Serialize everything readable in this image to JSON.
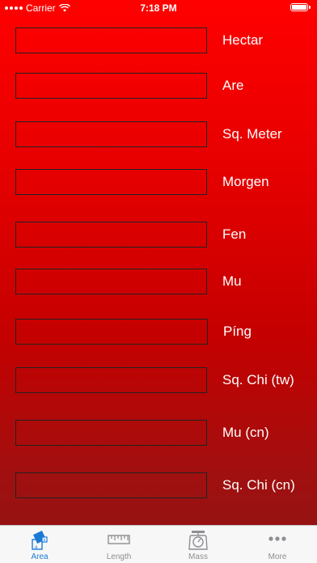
{
  "status_bar": {
    "carrier": "Carrier",
    "time": "7:18 PM"
  },
  "rows": [
    {
      "label": "Hectar",
      "value": ""
    },
    {
      "label": "Are",
      "value": ""
    },
    {
      "label": "Sq. Meter",
      "value": ""
    },
    {
      "label": "Morgen",
      "value": ""
    },
    {
      "label": "Fen",
      "value": ""
    },
    {
      "label": "Mu",
      "value": ""
    },
    {
      "label": "Píng",
      "value": ""
    },
    {
      "label": "Sq. Chi (tw)",
      "value": ""
    },
    {
      "label": "Mu (cn)",
      "value": ""
    },
    {
      "label": "Sq. Chi (cn)",
      "value": ""
    }
  ],
  "tabs": [
    {
      "label": "Area",
      "icon": "area-icon",
      "active": true
    },
    {
      "label": "Length",
      "icon": "ruler-icon",
      "active": false
    },
    {
      "label": "Mass",
      "icon": "scale-icon",
      "active": false
    },
    {
      "label": "More",
      "icon": "more-icon",
      "active": false
    }
  ],
  "colors": {
    "background_top": "#ff0000",
    "background_bottom": "#8e1414",
    "tab_active": "#1a7bd6",
    "tab_inactive": "#8e8e93"
  }
}
